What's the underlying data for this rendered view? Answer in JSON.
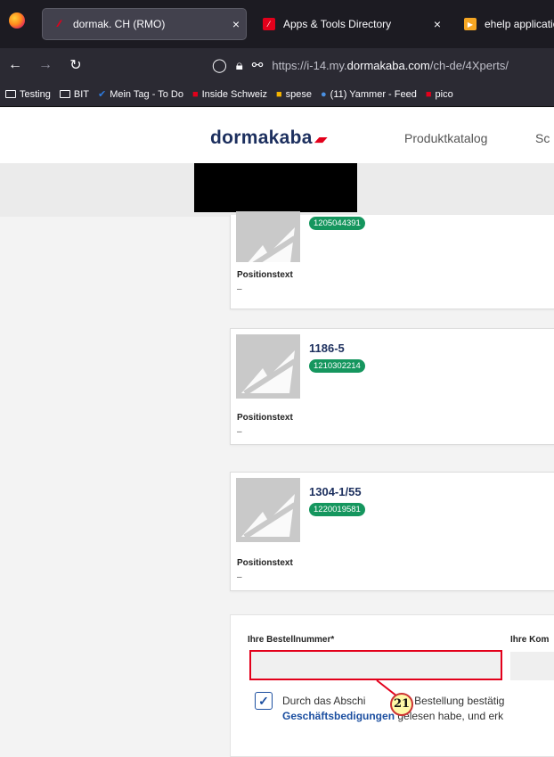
{
  "browser": {
    "tabs": [
      {
        "title": "dormak. CH (RMO)",
        "close": "×",
        "active": true
      },
      {
        "title": "Apps & Tools Directory",
        "close": "×",
        "active": false
      },
      {
        "title": "ehelp applicatio",
        "active": false
      }
    ],
    "url": {
      "prefix": "https://i-14.my.",
      "domain": "dormakaba.com",
      "path": "/ch-de/4Xperts/"
    },
    "bookmarks": [
      "Testing",
      "BIT",
      "Mein Tag - To Do",
      "Inside Schweiz",
      "spese",
      "(11) Yammer - Feed",
      "pico"
    ]
  },
  "header": {
    "logo": "dormakaba",
    "nav": [
      "Produktkatalog",
      "Sc"
    ]
  },
  "positions": [
    {
      "article": "",
      "material": "1205044391",
      "text_label": "Positionstext",
      "text_value": "–"
    },
    {
      "article": "1186-5",
      "material": "1210302214",
      "text_label": "Positionstext",
      "text_value": "–"
    },
    {
      "article": "1304-1/55",
      "material": "1220019581",
      "text_label": "Positionstext",
      "text_value": "–"
    }
  ],
  "order_form": {
    "order_number_label": "Ihre Bestellnummer*",
    "order_number_value": "",
    "commission_label": "Ihre Kom",
    "terms_line1_before": "Durch das Abschi",
    "terms_line1_after": "der Bestellung bestätig",
    "terms_link": "Geschäftsbedigungen",
    "terms_line2": " gelesen habe, und erk",
    "terms_checked": true
  },
  "annotation": {
    "marker": "21",
    "color": "#e3001b"
  },
  "colors": {
    "brand_red": "#e3001b",
    "brand_navy": "#1c2f5e",
    "badge_green": "#15965e",
    "link_blue": "#1c4fa0"
  }
}
